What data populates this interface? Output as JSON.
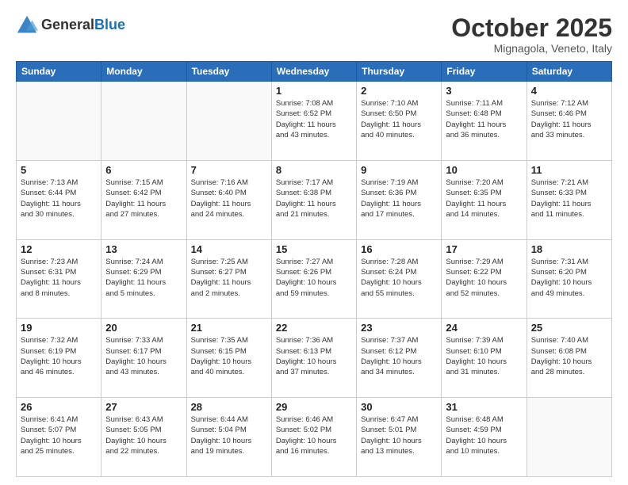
{
  "header": {
    "logo_line1": "General",
    "logo_line2": "Blue",
    "month": "October 2025",
    "location": "Mignagola, Veneto, Italy"
  },
  "weekdays": [
    "Sunday",
    "Monday",
    "Tuesday",
    "Wednesday",
    "Thursday",
    "Friday",
    "Saturday"
  ],
  "weeks": [
    [
      {
        "day": "",
        "info": ""
      },
      {
        "day": "",
        "info": ""
      },
      {
        "day": "",
        "info": ""
      },
      {
        "day": "1",
        "info": "Sunrise: 7:08 AM\nSunset: 6:52 PM\nDaylight: 11 hours\nand 43 minutes."
      },
      {
        "day": "2",
        "info": "Sunrise: 7:10 AM\nSunset: 6:50 PM\nDaylight: 11 hours\nand 40 minutes."
      },
      {
        "day": "3",
        "info": "Sunrise: 7:11 AM\nSunset: 6:48 PM\nDaylight: 11 hours\nand 36 minutes."
      },
      {
        "day": "4",
        "info": "Sunrise: 7:12 AM\nSunset: 6:46 PM\nDaylight: 11 hours\nand 33 minutes."
      }
    ],
    [
      {
        "day": "5",
        "info": "Sunrise: 7:13 AM\nSunset: 6:44 PM\nDaylight: 11 hours\nand 30 minutes."
      },
      {
        "day": "6",
        "info": "Sunrise: 7:15 AM\nSunset: 6:42 PM\nDaylight: 11 hours\nand 27 minutes."
      },
      {
        "day": "7",
        "info": "Sunrise: 7:16 AM\nSunset: 6:40 PM\nDaylight: 11 hours\nand 24 minutes."
      },
      {
        "day": "8",
        "info": "Sunrise: 7:17 AM\nSunset: 6:38 PM\nDaylight: 11 hours\nand 21 minutes."
      },
      {
        "day": "9",
        "info": "Sunrise: 7:19 AM\nSunset: 6:36 PM\nDaylight: 11 hours\nand 17 minutes."
      },
      {
        "day": "10",
        "info": "Sunrise: 7:20 AM\nSunset: 6:35 PM\nDaylight: 11 hours\nand 14 minutes."
      },
      {
        "day": "11",
        "info": "Sunrise: 7:21 AM\nSunset: 6:33 PM\nDaylight: 11 hours\nand 11 minutes."
      }
    ],
    [
      {
        "day": "12",
        "info": "Sunrise: 7:23 AM\nSunset: 6:31 PM\nDaylight: 11 hours\nand 8 minutes."
      },
      {
        "day": "13",
        "info": "Sunrise: 7:24 AM\nSunset: 6:29 PM\nDaylight: 11 hours\nand 5 minutes."
      },
      {
        "day": "14",
        "info": "Sunrise: 7:25 AM\nSunset: 6:27 PM\nDaylight: 11 hours\nand 2 minutes."
      },
      {
        "day": "15",
        "info": "Sunrise: 7:27 AM\nSunset: 6:26 PM\nDaylight: 10 hours\nand 59 minutes."
      },
      {
        "day": "16",
        "info": "Sunrise: 7:28 AM\nSunset: 6:24 PM\nDaylight: 10 hours\nand 55 minutes."
      },
      {
        "day": "17",
        "info": "Sunrise: 7:29 AM\nSunset: 6:22 PM\nDaylight: 10 hours\nand 52 minutes."
      },
      {
        "day": "18",
        "info": "Sunrise: 7:31 AM\nSunset: 6:20 PM\nDaylight: 10 hours\nand 49 minutes."
      }
    ],
    [
      {
        "day": "19",
        "info": "Sunrise: 7:32 AM\nSunset: 6:19 PM\nDaylight: 10 hours\nand 46 minutes."
      },
      {
        "day": "20",
        "info": "Sunrise: 7:33 AM\nSunset: 6:17 PM\nDaylight: 10 hours\nand 43 minutes."
      },
      {
        "day": "21",
        "info": "Sunrise: 7:35 AM\nSunset: 6:15 PM\nDaylight: 10 hours\nand 40 minutes."
      },
      {
        "day": "22",
        "info": "Sunrise: 7:36 AM\nSunset: 6:13 PM\nDaylight: 10 hours\nand 37 minutes."
      },
      {
        "day": "23",
        "info": "Sunrise: 7:37 AM\nSunset: 6:12 PM\nDaylight: 10 hours\nand 34 minutes."
      },
      {
        "day": "24",
        "info": "Sunrise: 7:39 AM\nSunset: 6:10 PM\nDaylight: 10 hours\nand 31 minutes."
      },
      {
        "day": "25",
        "info": "Sunrise: 7:40 AM\nSunset: 6:08 PM\nDaylight: 10 hours\nand 28 minutes."
      }
    ],
    [
      {
        "day": "26",
        "info": "Sunrise: 6:41 AM\nSunset: 5:07 PM\nDaylight: 10 hours\nand 25 minutes."
      },
      {
        "day": "27",
        "info": "Sunrise: 6:43 AM\nSunset: 5:05 PM\nDaylight: 10 hours\nand 22 minutes."
      },
      {
        "day": "28",
        "info": "Sunrise: 6:44 AM\nSunset: 5:04 PM\nDaylight: 10 hours\nand 19 minutes."
      },
      {
        "day": "29",
        "info": "Sunrise: 6:46 AM\nSunset: 5:02 PM\nDaylight: 10 hours\nand 16 minutes."
      },
      {
        "day": "30",
        "info": "Sunrise: 6:47 AM\nSunset: 5:01 PM\nDaylight: 10 hours\nand 13 minutes."
      },
      {
        "day": "31",
        "info": "Sunrise: 6:48 AM\nSunset: 4:59 PM\nDaylight: 10 hours\nand 10 minutes."
      },
      {
        "day": "",
        "info": ""
      }
    ]
  ]
}
